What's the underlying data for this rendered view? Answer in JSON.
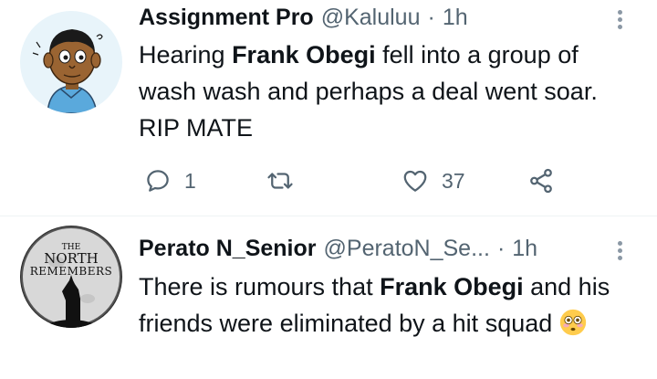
{
  "tweets": [
    {
      "author_name": "Assignment Pro",
      "handle": "@Kaluluu",
      "separator": "·",
      "time": "1h",
      "text_parts": [
        "Hearing ",
        "Frank Obegi",
        " fell into a group of wash wash and perhaps a deal went soar. RIP MATE"
      ],
      "actions": {
        "reply_count": "1",
        "retweet_count": "",
        "like_count": "37"
      }
    },
    {
      "author_name": "Perato N_Senior",
      "handle": "@PeratoN_Se...",
      "separator": "·",
      "time": "1h",
      "text_parts": [
        "There is rumours that ",
        "Frank Obegi",
        " and his friends were eliminated by a hit squad "
      ],
      "avatar_text": [
        "THE",
        "NORTH",
        "REMEMBERS"
      ]
    }
  ],
  "icons": {
    "reply": "reply-icon",
    "retweet": "retweet-icon",
    "like": "heart-icon",
    "share": "share-icon",
    "more": "more-vertical-icon",
    "emoji": "flushed-face-emoji"
  },
  "colors": {
    "text": "#0f1419",
    "secondary": "#536471",
    "divider": "#eff3f4"
  }
}
